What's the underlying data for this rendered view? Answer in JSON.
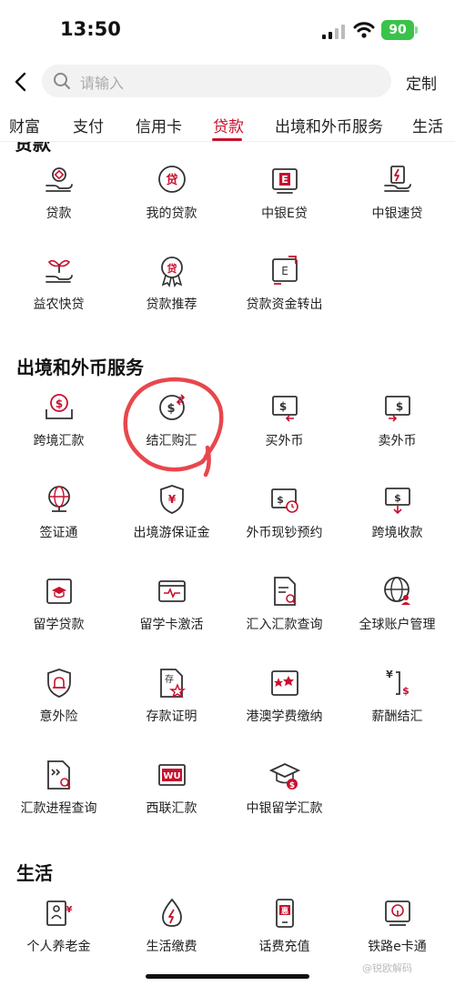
{
  "status": {
    "time": "13:50",
    "battery": "90"
  },
  "search": {
    "placeholder": "请输入"
  },
  "header": {
    "custom_label": "定制"
  },
  "tabs": [
    {
      "label": "财富"
    },
    {
      "label": "支付"
    },
    {
      "label": "信用卡"
    },
    {
      "label": "贷款"
    },
    {
      "label": "出境和外币服务"
    },
    {
      "label": "生活"
    }
  ],
  "loan": {
    "items": [
      {
        "label": "贷款",
        "icon": "hand-coin-icon"
      },
      {
        "label": "我的贷款",
        "icon": "loan-badge-icon"
      },
      {
        "label": "中银E贷",
        "icon": "e-loan-icon"
      },
      {
        "label": "中银速贷",
        "icon": "fast-loan-icon"
      },
      {
        "label": "益农快贷",
        "icon": "sprout-icon"
      },
      {
        "label": "贷款推荐",
        "icon": "loan-ribbon-icon"
      },
      {
        "label": "贷款资金转出",
        "icon": "transfer-out-icon"
      }
    ]
  },
  "fx": {
    "title": "出境和外币服务",
    "items": [
      {
        "label": "跨境汇款",
        "icon": "cross-remit-icon"
      },
      {
        "label": "结汇购汇",
        "icon": "exchange-icon"
      },
      {
        "label": "买外币",
        "icon": "buy-fx-icon"
      },
      {
        "label": "卖外币",
        "icon": "sell-fx-icon"
      },
      {
        "label": "签证通",
        "icon": "globe-icon"
      },
      {
        "label": "出境游保证金",
        "icon": "shield-yen-icon"
      },
      {
        "label": "外币现钞预约",
        "icon": "cash-clock-icon"
      },
      {
        "label": "跨境收款",
        "icon": "receive-icon"
      },
      {
        "label": "留学贷款",
        "icon": "study-loan-icon"
      },
      {
        "label": "留学卡激活",
        "icon": "card-activate-icon"
      },
      {
        "label": "汇入汇款查询",
        "icon": "doc-search-icon"
      },
      {
        "label": "全球账户管理",
        "icon": "globe-user-icon"
      },
      {
        "label": "意外险",
        "icon": "shield-alarm-icon"
      },
      {
        "label": "存款证明",
        "icon": "deposit-cert-icon"
      },
      {
        "label": "港澳学费缴纳",
        "icon": "tuition-icon"
      },
      {
        "label": "薪酬结汇",
        "icon": "salary-fx-icon"
      },
      {
        "label": "汇款进程查询",
        "icon": "progress-search-icon"
      },
      {
        "label": "西联汇款",
        "icon": "western-union-icon"
      },
      {
        "label": "中银留学汇款",
        "icon": "grad-cap-icon"
      }
    ]
  },
  "life": {
    "title": "生活",
    "items": [
      {
        "label": "个人养老金",
        "icon": "pension-icon"
      },
      {
        "label": "生活缴费",
        "icon": "utility-icon"
      },
      {
        "label": "话费充值",
        "icon": "phone-topup-icon"
      },
      {
        "label": "铁路e卡通",
        "icon": "railway-icon"
      }
    ]
  },
  "watermark": "@锐欧解码",
  "colors": {
    "accent": "#c8102e",
    "annotation": "#e8474c",
    "battery": "#3ac24a"
  }
}
